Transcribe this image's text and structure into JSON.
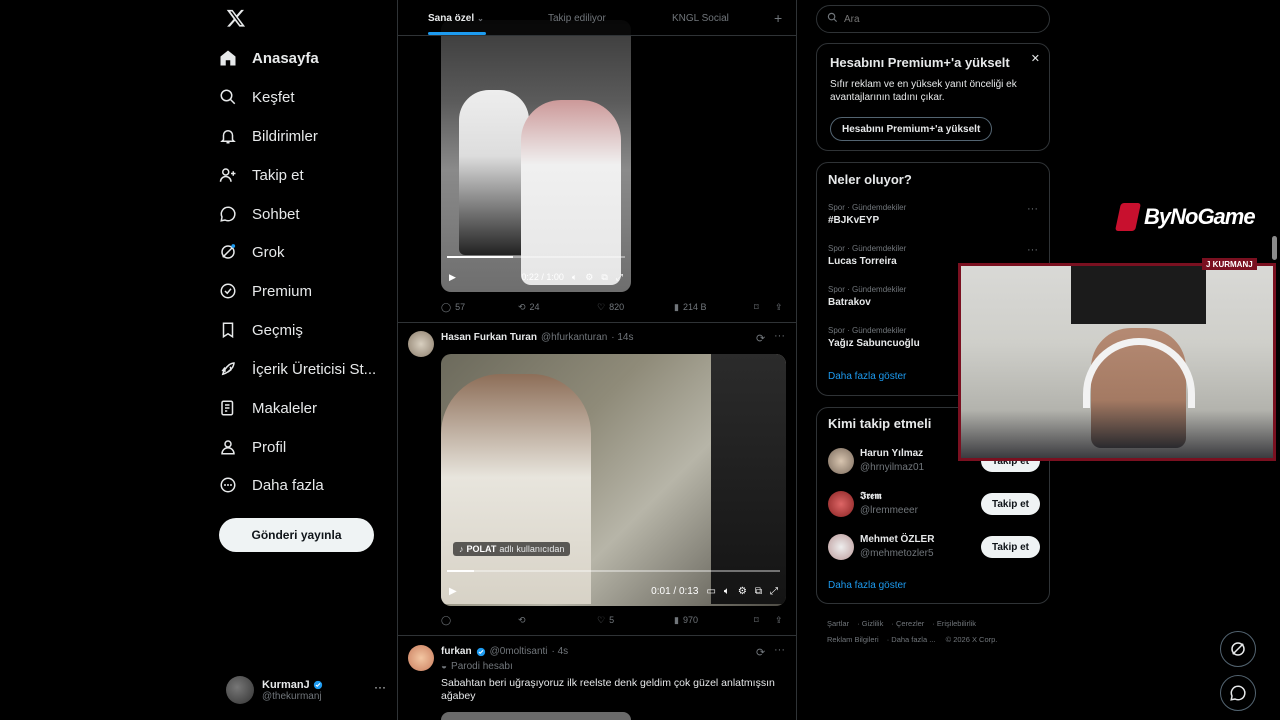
{
  "nav": {
    "items": [
      {
        "label": "Anasayfa",
        "icon": "home-icon"
      },
      {
        "label": "Keşfet",
        "icon": "search-icon"
      },
      {
        "label": "Bildirimler",
        "icon": "bell-icon"
      },
      {
        "label": "Takip et",
        "icon": "person-add-icon"
      },
      {
        "label": "Sohbet",
        "icon": "chat-icon"
      },
      {
        "label": "Grok",
        "icon": "grok-icon"
      },
      {
        "label": "Premium",
        "icon": "premium-icon"
      },
      {
        "label": "Geçmiş",
        "icon": "bookmark-icon"
      },
      {
        "label": "İçerik Üreticisi St...",
        "icon": "rocket-icon"
      },
      {
        "label": "Makaleler",
        "icon": "article-icon"
      },
      {
        "label": "Profil",
        "icon": "profile-icon"
      },
      {
        "label": "Daha fazla",
        "icon": "more-circle-icon"
      }
    ],
    "post_button": "Gönderi yayınla",
    "account": {
      "name": "KurmanJ",
      "handle": "@thekurmanj"
    }
  },
  "tabs": [
    "Sana özel",
    "Takip ediliyor",
    "KNGL Social"
  ],
  "post1": {
    "video_time": "0:22 / 1:00",
    "video_progress": 0.37,
    "replies": "57",
    "reposts": "24",
    "likes": "820",
    "views": "214 B"
  },
  "post2": {
    "name": "Hasan Furkan Turan",
    "handle": "@hfurkanturan",
    "time": "· 14s",
    "video_time": "0:01 / 0:13",
    "video_progress": 0.08,
    "badge_user": "POLAT",
    "badge_suffix": "adlı kullanıcıdan",
    "replies": "",
    "reposts": "",
    "likes": "5",
    "views": "970"
  },
  "post3": {
    "name": "furkan",
    "handle": "@0moltisanti",
    "time": "· 4s",
    "parody": "Parodi hesabı",
    "text": "Sabahtan beri uğraşıyoruz ilk reelste denk geldim çok güzel anlatmışsın ağabey"
  },
  "search": {
    "placeholder": "Ara"
  },
  "premium": {
    "title": "Hesabını Premium+'a yükselt",
    "body": "Sıfır reklam ve en yüksek yanıt önceliği ek avantajlarının tadını çıkar.",
    "button": "Hesabını Premium+'a yükselt"
  },
  "trends": {
    "title": "Neler oluyor?",
    "items": [
      {
        "context": "Spor · Gündemdekiler",
        "topic": "#BJKvEYP"
      },
      {
        "context": "Spor · Gündemdekiler",
        "topic": "Lucas Torreira"
      },
      {
        "context": "Spor · Gündemdekiler",
        "topic": "Batrakov"
      },
      {
        "context": "Spor · Gündemdekiler",
        "topic": "Yağız Sabuncuoğlu"
      }
    ],
    "show_more": "Daha fazla göster"
  },
  "who_to_follow": {
    "title": "Kimi takip etmeli",
    "items": [
      {
        "name": "Harun Yılmaz",
        "handle": "@hrnyilmaz01",
        "button": "Takip et"
      },
      {
        "name": "𝕴𝖗𝖊𝖒",
        "handle": "@lremmeeer",
        "button": "Takip et"
      },
      {
        "name": "Mehmet ÖZLER",
        "handle": "@mehmetozler5",
        "button": "Takip et"
      }
    ],
    "show_more": "Daha fazla göster"
  },
  "footer": {
    "line1": [
      "Şartlar",
      "Gizlilik",
      "Çerezler",
      "Erişilebilirlik"
    ],
    "line2": [
      "Reklam Bilgileri",
      "Daha fazla ...",
      "© 2026 X Corp."
    ]
  },
  "overlay": {
    "brand": "ByNoGame",
    "webcam_tag": "J  KURMANJ"
  },
  "colors": {
    "accent": "#1d9bf0",
    "background": "#000000",
    "brand_red": "#c8102e"
  }
}
